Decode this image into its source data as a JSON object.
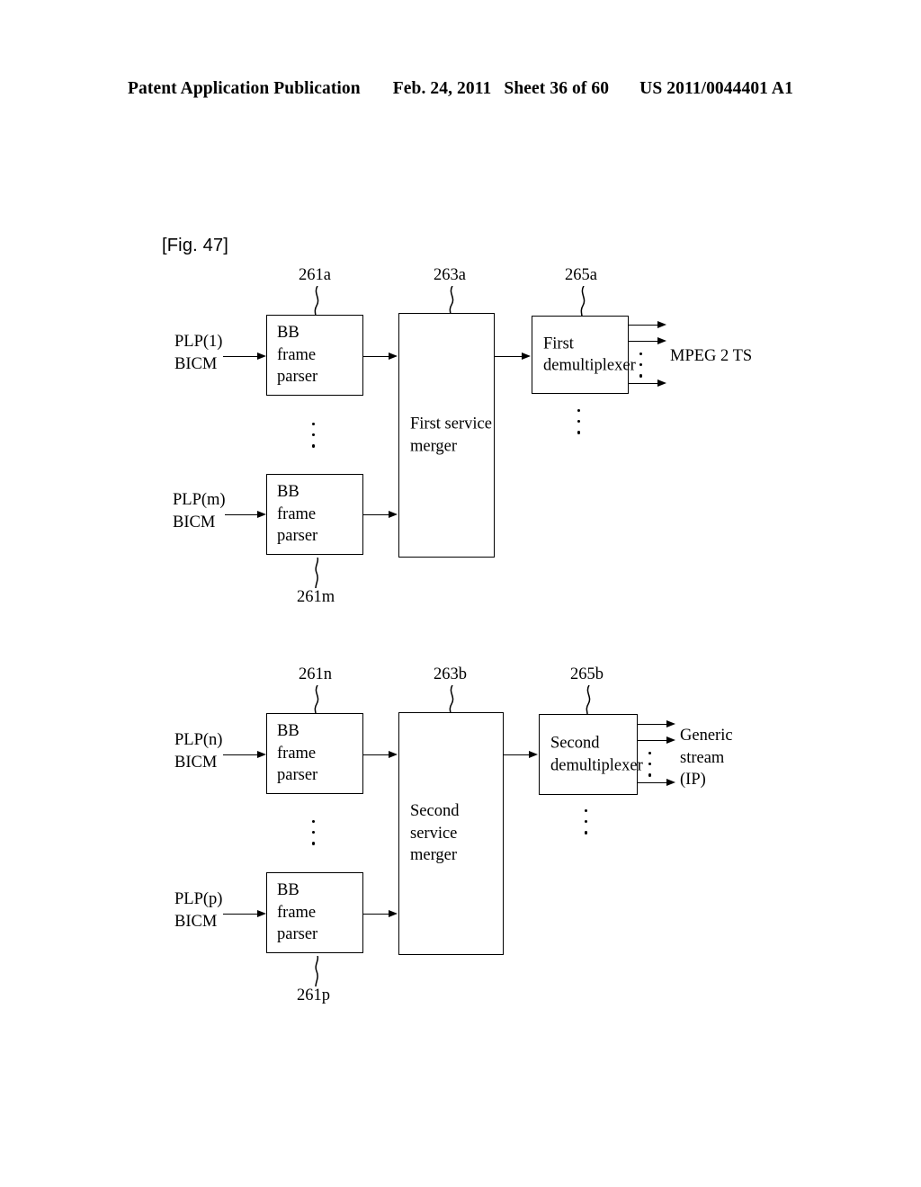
{
  "header": {
    "publication": "Patent Application Publication",
    "date": "Feb. 24, 2011",
    "sheet": "Sheet 36 of 60",
    "patent_number": "US 2011/0044401 A1"
  },
  "figure": {
    "label": "[Fig. 47]"
  },
  "top_diagram": {
    "refnums": {
      "parser_a": "261a",
      "parser_m": "261m",
      "merger": "263a",
      "demux": "265a"
    },
    "inputs": [
      {
        "label": "PLP(1)\nBICM"
      },
      {
        "label": "PLP(m)\nBICM"
      }
    ],
    "parsers": [
      {
        "label": "BB\nframe\nparser"
      },
      {
        "label": "BB\nframe\nparser"
      }
    ],
    "merger": {
      "label": "First service\nmerger"
    },
    "demux": {
      "label": "First\ndemultiplexer"
    },
    "output": {
      "label": "MPEG 2 TS"
    }
  },
  "bottom_diagram": {
    "refnums": {
      "parser_n": "261n",
      "parser_p": "261p",
      "merger": "263b",
      "demux": "265b"
    },
    "inputs": [
      {
        "label": "PLP(n)\nBICM"
      },
      {
        "label": "PLP(p)\nBICM"
      }
    ],
    "parsers": [
      {
        "label": "BB\nframe\nparser"
      },
      {
        "label": "BB\nframe\nparser"
      }
    ],
    "merger": {
      "label": "Second service\nmerger"
    },
    "demux": {
      "label": "Second\ndemultiplexer"
    },
    "output": {
      "label": "Generic\nstream\n(IP)"
    }
  },
  "colors": {
    "ink": "#000000",
    "paper": "#ffffff"
  }
}
